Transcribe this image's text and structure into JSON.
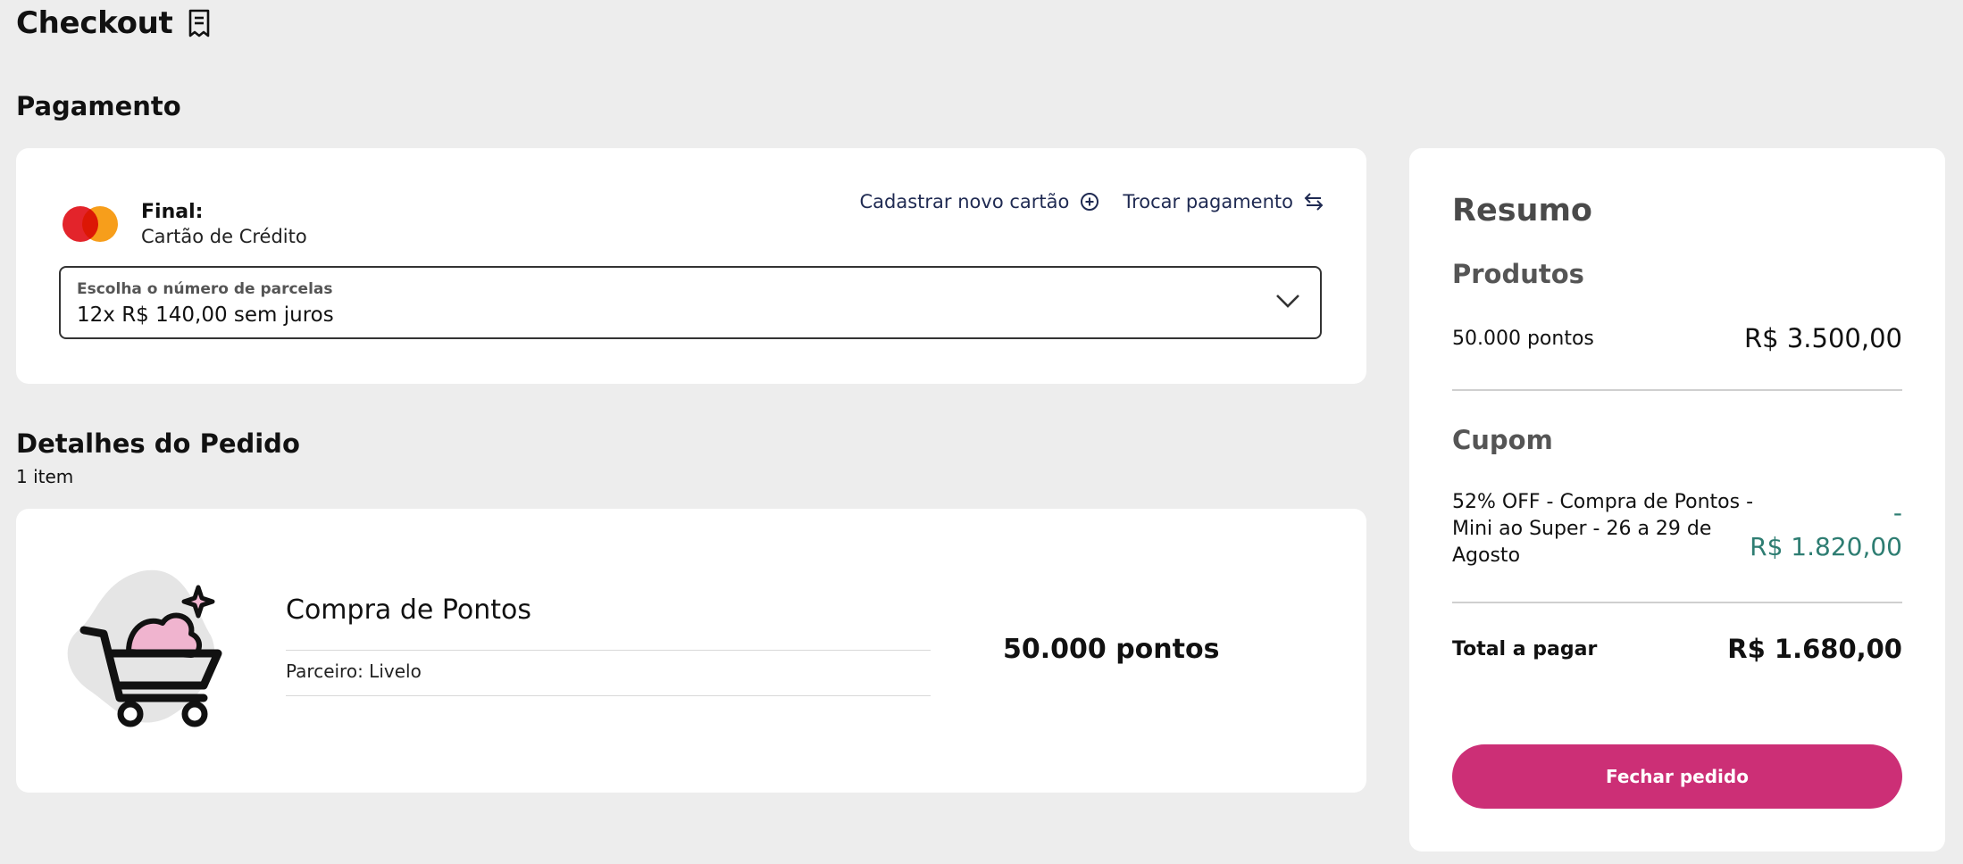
{
  "page": {
    "title": "Checkout"
  },
  "payment": {
    "section_title": "Pagamento",
    "card_final_label": "Final:",
    "card_type": "Cartão de Crédito",
    "register_card_link": "Cadastrar novo cartão",
    "change_payment_link": "Trocar pagamento",
    "installments": {
      "label": "Escolha o número de parcelas",
      "value": "12x R$ 140,00 sem juros"
    }
  },
  "order": {
    "section_title": "Detalhes do Pedido",
    "item_count": "1 item",
    "items": [
      {
        "name": "Compra de Pontos",
        "partner": "Parceiro: Livelo",
        "points": "50.000 pontos"
      }
    ]
  },
  "summary": {
    "title": "Resumo",
    "products_label": "Produtos",
    "products_qty": "50.000 pontos",
    "products_amount": "R$ 3.500,00",
    "coupon_label": "Cupom",
    "coupon_desc": "52% OFF - Compra de Pontos - Mini ao Super - 26 a 29 de Agosto",
    "coupon_amount_sign": "-",
    "coupon_amount": "R$ 1.820,00",
    "total_label": "Total a pagar",
    "total_amount": "R$ 1.680,00",
    "cta_label": "Fechar pedido"
  },
  "colors": {
    "primary": "#cc2f76",
    "discount": "#2e7d72",
    "link": "#1f2a52",
    "background": "#ededed"
  },
  "icons": {
    "page_title": "receipt-icon",
    "register_card": "plus-circle-icon",
    "change_payment": "swap-arrows-icon",
    "select": "chevron-down-icon",
    "card_brand": "mastercard-logo",
    "product": "shopping-cart-icon"
  }
}
